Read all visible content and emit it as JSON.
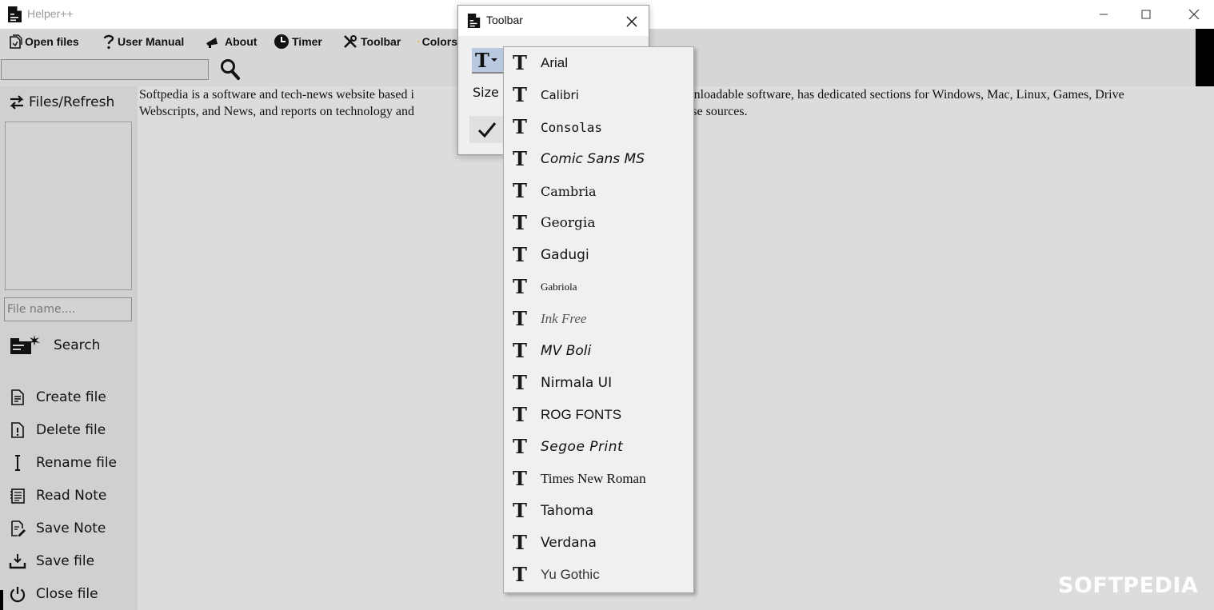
{
  "window": {
    "title": "Helper++"
  },
  "menu": {
    "open_files": "Open files",
    "user_manual": "User Manual",
    "about": "About",
    "timer": "Timer",
    "toolbar": "Toolbar",
    "colors": "Colors"
  },
  "sidebar": {
    "refresh_label": "Files/Refresh",
    "filename_placeholder": "File name....",
    "search_label": "Search",
    "buttons": [
      {
        "label": "Create file",
        "icon": "document-icon"
      },
      {
        "label": "Delete file",
        "icon": "delete-document-icon"
      },
      {
        "label": "Rename file",
        "icon": "text-cursor-icon"
      },
      {
        "label": "Read Note",
        "icon": "note-icon"
      },
      {
        "label": "Save Note",
        "icon": "edit-note-icon"
      },
      {
        "label": "Save file",
        "icon": "download-tray-icon"
      },
      {
        "label": "Close file",
        "icon": "power-icon"
      }
    ]
  },
  "content": {
    "line1_left": "Softpedia is a software and tech-news website based i",
    "line1_right": "s downloadable software, has dedicated sections for Windows, Mac, Linux, Games, Drive",
    "line2_left": "Webscripts, and News, and reports on technology and",
    "line2_right": "-house sources."
  },
  "dialog": {
    "title": "Toolbar",
    "font_button_glyph": "T",
    "size_label": "Size"
  },
  "fonts": {
    "items": [
      {
        "name": "Arial"
      },
      {
        "name": "Calibri"
      },
      {
        "name": "Consolas"
      },
      {
        "name": "Comic Sans MS"
      },
      {
        "name": "Cambria"
      },
      {
        "name": "Georgia"
      },
      {
        "name": "Gadugi"
      },
      {
        "name": "Gabriola"
      },
      {
        "name": "Ink Free"
      },
      {
        "name": "MV Boli"
      },
      {
        "name": "Nirmala UI"
      },
      {
        "name": "ROG FONTS"
      },
      {
        "name": "Segoe Print"
      },
      {
        "name": "Times New Roman"
      },
      {
        "name": "Tahoma"
      },
      {
        "name": "Verdana"
      },
      {
        "name": "Yu Gothic"
      }
    ],
    "glyph": "T"
  },
  "watermark": "SOFTPEDIA",
  "colors": {
    "accent_font_button": "#b9c9df",
    "palette_icon": "#f7941d",
    "content_bg": "#dcdcdc",
    "sidebar_bg": "#d0d0d0"
  }
}
